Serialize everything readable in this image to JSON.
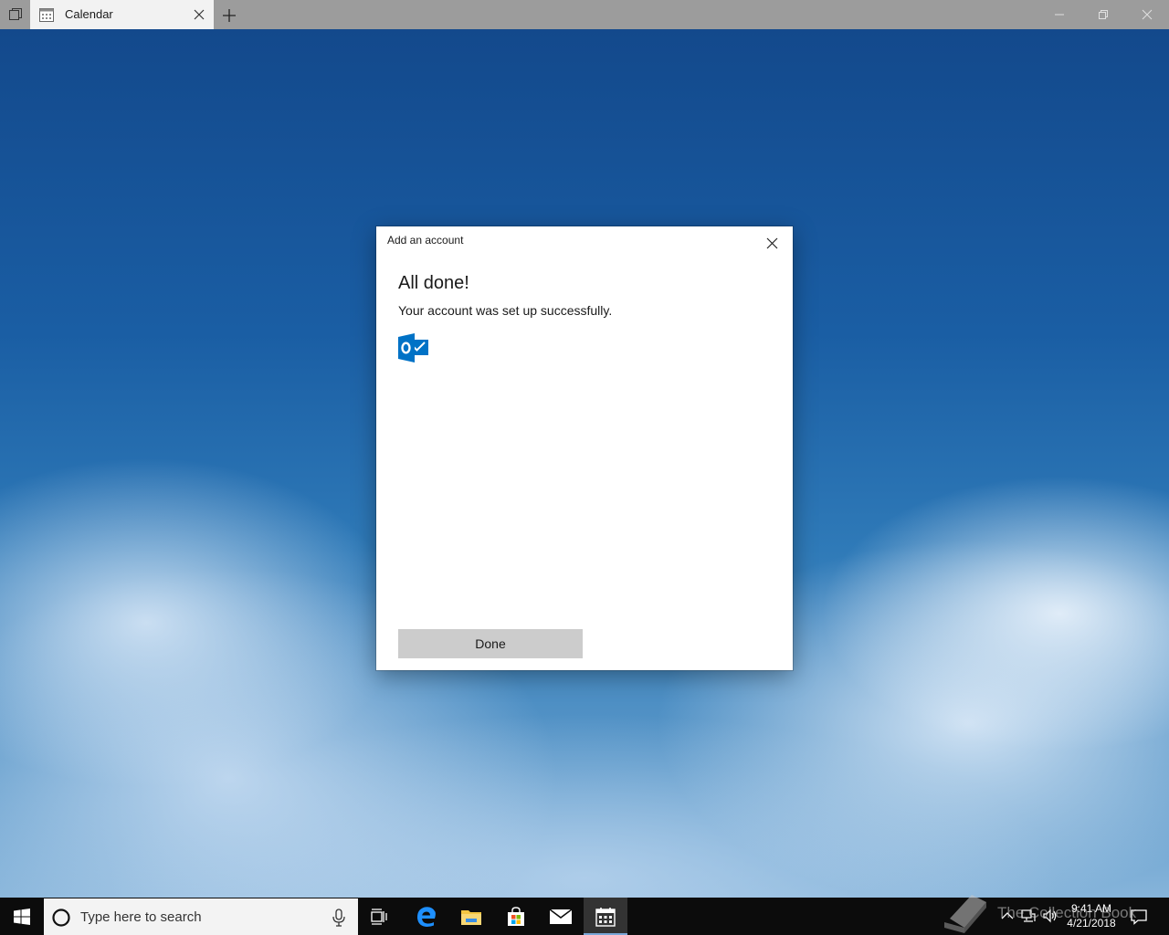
{
  "titlebar": {
    "tab_title": "Calendar"
  },
  "dialog": {
    "title": "Add an account",
    "heading": "All done!",
    "message": "Your account was set up successfully.",
    "account_icon": "outlook-icon",
    "done_label": "Done"
  },
  "taskbar": {
    "search_placeholder": "Type here to search",
    "apps": [
      "task-view-icon",
      "edge-icon",
      "file-explorer-icon",
      "store-icon",
      "mail-icon",
      "calendar-icon"
    ],
    "clock_time": "9:41 AM",
    "clock_date": "4/21/2018"
  },
  "watermark": {
    "text": "The Collection Book"
  },
  "colors": {
    "accent": "#0078d4",
    "outlook_blue": "#0072c6",
    "dialog_button": "#cccccc",
    "taskbar": "#0c0c0c"
  }
}
